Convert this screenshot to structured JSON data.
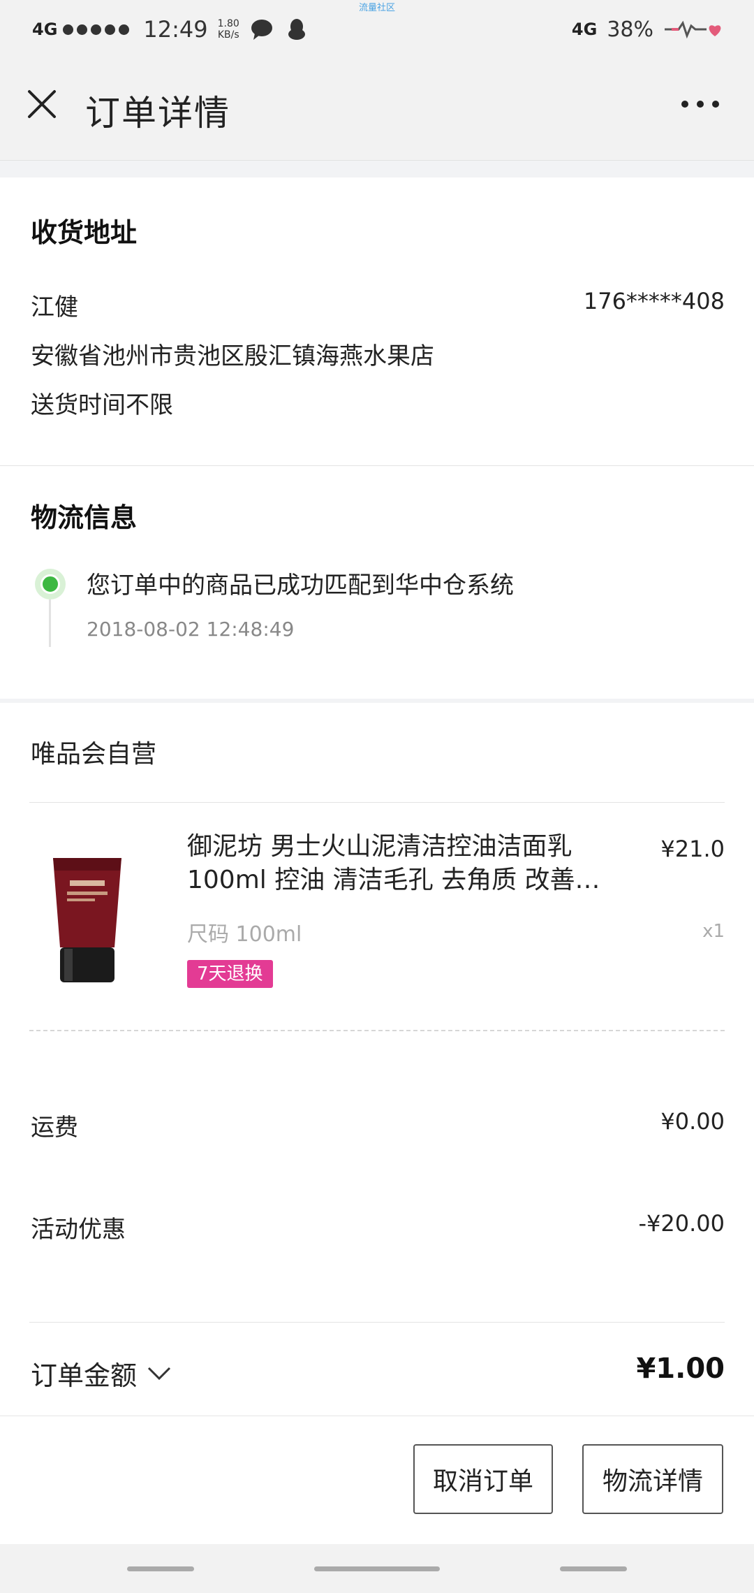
{
  "status_bar": {
    "network_left": "4G",
    "time": "12:49",
    "speed_value": "1.80",
    "speed_unit": "KB/s",
    "center_text": "流量社区",
    "network_right": "4G",
    "battery": "38%",
    "icons": [
      "chat-bubble-icon",
      "qq-penguin-icon",
      "heartbeat-icon"
    ]
  },
  "header": {
    "title": "订单详情",
    "close_icon": "close-icon",
    "more_icon": "more-dots-icon"
  },
  "address": {
    "section_title": "收货地址",
    "name": "江健",
    "phone": "176*****408",
    "address": "安徽省池州市贵池区殷汇镇海燕水果店",
    "delivery_time": "送货时间不限"
  },
  "logistics": {
    "section_title": "物流信息",
    "status_text": "您订单中的商品已成功匹配到华中仓系统",
    "status_time": "2018-08-02 12:48:49",
    "status_color": "#3db842"
  },
  "order": {
    "store_name": "唯品会自营",
    "product": {
      "title": "御泥坊 男士火山泥清洁控油洁面乳100ml 控油 清洁毛孔 去角质 改善…",
      "price": "¥21.0",
      "spec": "尺码 100ml",
      "quantity": "x1",
      "badge": "7天退换",
      "badge_color": "#e33b94"
    },
    "fees": [
      {
        "label": "运费",
        "value": "¥0.00"
      },
      {
        "label": "活动优惠",
        "value": "-¥20.00"
      }
    ],
    "total_label": "订单金额",
    "total_value": "¥1.00"
  },
  "actions": {
    "cancel_label": "取消订单",
    "logistics_label": "物流详情"
  }
}
